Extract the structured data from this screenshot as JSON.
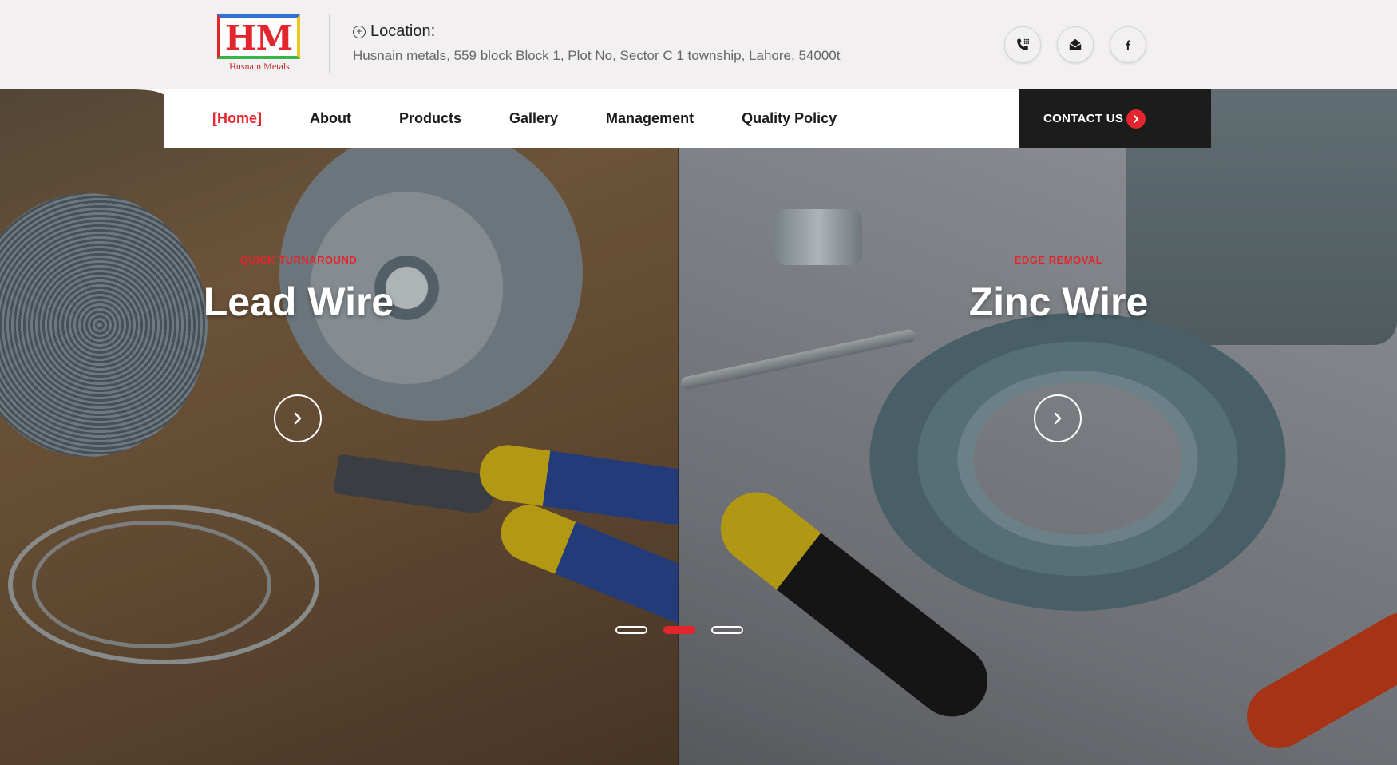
{
  "header": {
    "logo": {
      "letters": "HM",
      "caption": "Husnain Metals"
    },
    "location": {
      "title": "Location:",
      "address": "Husnain metals, 559 block Block 1, Plot No, Sector C 1 township, Lahore, 54000t"
    },
    "social_icons": [
      "phone-icon",
      "mail-icon",
      "facebook-icon"
    ]
  },
  "nav": {
    "items": [
      {
        "label": "[Home]",
        "active": true
      },
      {
        "label": "About",
        "active": false
      },
      {
        "label": "Products",
        "active": false
      },
      {
        "label": "Gallery",
        "active": false
      },
      {
        "label": "Management",
        "active": false
      },
      {
        "label": "Quality Policy",
        "active": false
      }
    ],
    "contact_label": "CONTACT US"
  },
  "slides": [
    {
      "tag": "QUICK TURNAROUND",
      "title": "Lead Wire"
    },
    {
      "tag": "EDGE REMOVAL",
      "title": "Zinc Wire"
    }
  ],
  "carousel": {
    "count": 3,
    "active_index": 1
  },
  "colors": {
    "accent": "#e3262d",
    "dark": "#1c1c1c",
    "header_bg": "#f2f0f1"
  }
}
